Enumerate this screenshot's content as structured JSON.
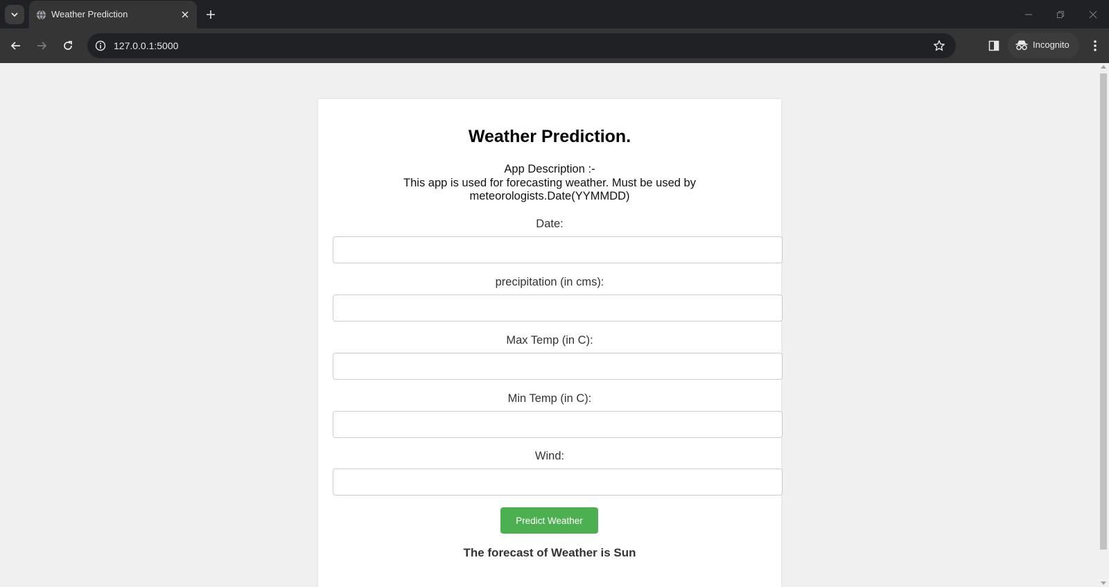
{
  "browser": {
    "tab_title": "Weather Prediction",
    "url": "127.0.0.1:5000",
    "incognito_label": "Incognito"
  },
  "page": {
    "title": "Weather Prediction.",
    "description_heading": "App Description :-",
    "description_body": "This app is used for forecasting weather. Must be used by meteorologists.Date(YYMMDD)",
    "fields": [
      {
        "label": "Date:",
        "value": ""
      },
      {
        "label": "precipitation (in cms):",
        "value": ""
      },
      {
        "label": "Max Temp (in C):",
        "value": ""
      },
      {
        "label": "Min Temp (in C):",
        "value": ""
      },
      {
        "label": "Wind:",
        "value": ""
      }
    ],
    "submit_label": "Predict Weather",
    "result_text": "The forecast of Weather is Sun"
  },
  "colors": {
    "button_green": "#4caf50",
    "chrome_dark": "#202124",
    "page_background": "#f0f0f0"
  }
}
